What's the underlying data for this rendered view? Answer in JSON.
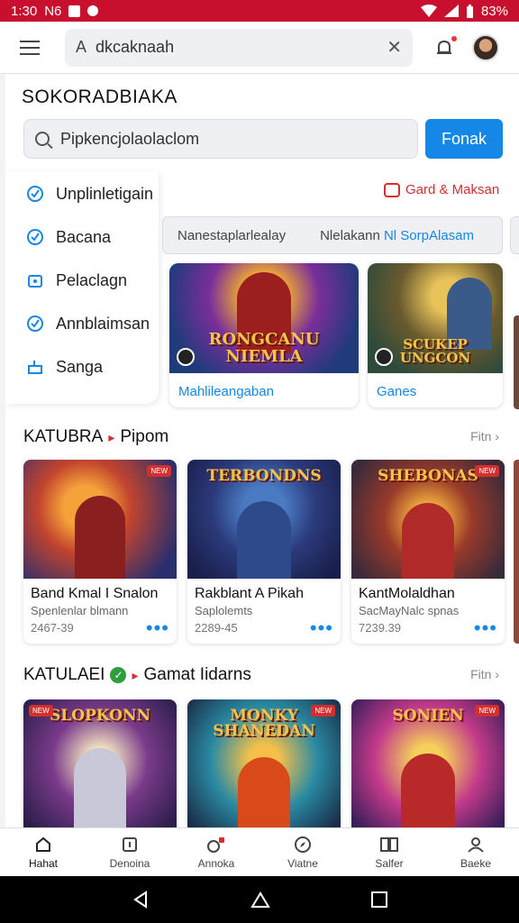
{
  "status_bar": {
    "time": "1:30",
    "carrier": "N6",
    "battery": "83%"
  },
  "app_bar": {
    "search_text": "dkcaknaah"
  },
  "section": {
    "title": "SOKORADBIAKA"
  },
  "main_search": {
    "placeholder": "Pipkencjolaolaclom",
    "button_label": "Fonak"
  },
  "side_menu": {
    "items": [
      {
        "label": "Unplinletigain",
        "icon": "check-circle-icon"
      },
      {
        "label": "Bacana",
        "icon": "check-circle-icon"
      },
      {
        "label": "Pelaclagn",
        "icon": "bag-icon"
      },
      {
        "label": "Annblaimsan",
        "icon": "check-circle-icon"
      },
      {
        "label": "Sanga",
        "icon": "thumb-icon"
      }
    ]
  },
  "promo": {
    "label": "Gard & Maksan"
  },
  "filters": {
    "items": [
      "Nanestaplarlealay",
      "Nlelakann",
      "Nl SorpAlasam"
    ]
  },
  "featured": [
    {
      "art_title": "RONGCANU NIEMLA",
      "caption": "Mahlileangaban"
    },
    {
      "art_title": "SCUKEP UNGCON",
      "caption": "Ganes"
    }
  ],
  "row1": {
    "title": "KATUBRA",
    "subtitle": "Pipom",
    "more": "Fitn",
    "cards": [
      {
        "art_title": "",
        "name": "Band Kmal I Snalon",
        "sub": "Spenlenlar blmann",
        "meta": "2467-39",
        "badge": "NEW"
      },
      {
        "art_title": "TERBONDNS",
        "name": "Rakblant A Pikah",
        "sub": "Saplolemts",
        "meta": "2289-45",
        "badge": ""
      },
      {
        "art_title": "SHEBONAS",
        "name": "KantMolaldhan",
        "sub": "SacMayNalc spnas",
        "meta": "7239.39",
        "badge": "NEW"
      }
    ]
  },
  "row2": {
    "title": "KATULAEI",
    "subtitle": "Gamat Iidarns",
    "more": "Fitn",
    "cards": [
      {
        "art_title": "SLOPKONN",
        "name": "",
        "badge": "NEW"
      },
      {
        "art_title": "MONKY SHANEDAN",
        "name": "",
        "badge": "NEW"
      },
      {
        "art_title": "SONIEN",
        "name": "",
        "badge": "NEW"
      }
    ]
  },
  "bottom_nav": [
    {
      "label": "Hahat",
      "icon": "home-icon"
    },
    {
      "label": "Denoina",
      "icon": "info-icon"
    },
    {
      "label": "Annoka",
      "icon": "game-icon"
    },
    {
      "label": "Viatne",
      "icon": "compass-icon"
    },
    {
      "label": "Salfer",
      "icon": "book-icon"
    },
    {
      "label": "Baeke",
      "icon": "profile-icon"
    }
  ],
  "colors": {
    "status_bar": "#c8102e",
    "accent": "#1587e6",
    "promo": "#d32f2f"
  }
}
